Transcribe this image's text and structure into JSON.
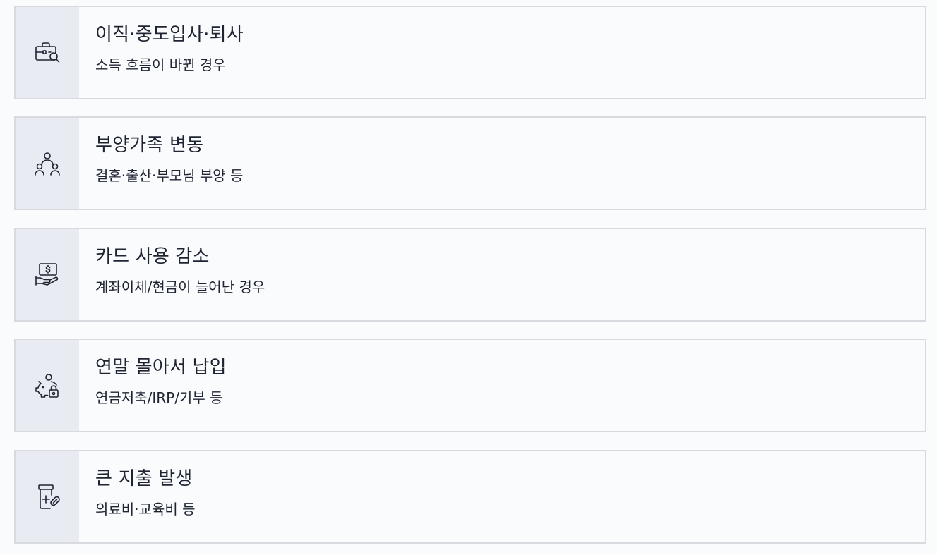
{
  "items": [
    {
      "title": "이직·중도입사·퇴사",
      "subtitle": "소득 흐름이 바뀐 경우",
      "icon": "briefcase-search-icon"
    },
    {
      "title": "부양가족 변동",
      "subtitle": "결혼·출산·부모님 부양 등",
      "icon": "family-people-icon"
    },
    {
      "title": "카드 사용 감소",
      "subtitle": "계좌이체/현금이 늘어난 경우",
      "icon": "hand-money-icon"
    },
    {
      "title": "연말 몰아서 납입",
      "subtitle": "연금저축/IRP/기부 등",
      "icon": "piggy-bank-lock-icon"
    },
    {
      "title": "큰 지출 발생",
      "subtitle": "의료비·교육비 등",
      "icon": "medicine-bottle-icon"
    }
  ]
}
